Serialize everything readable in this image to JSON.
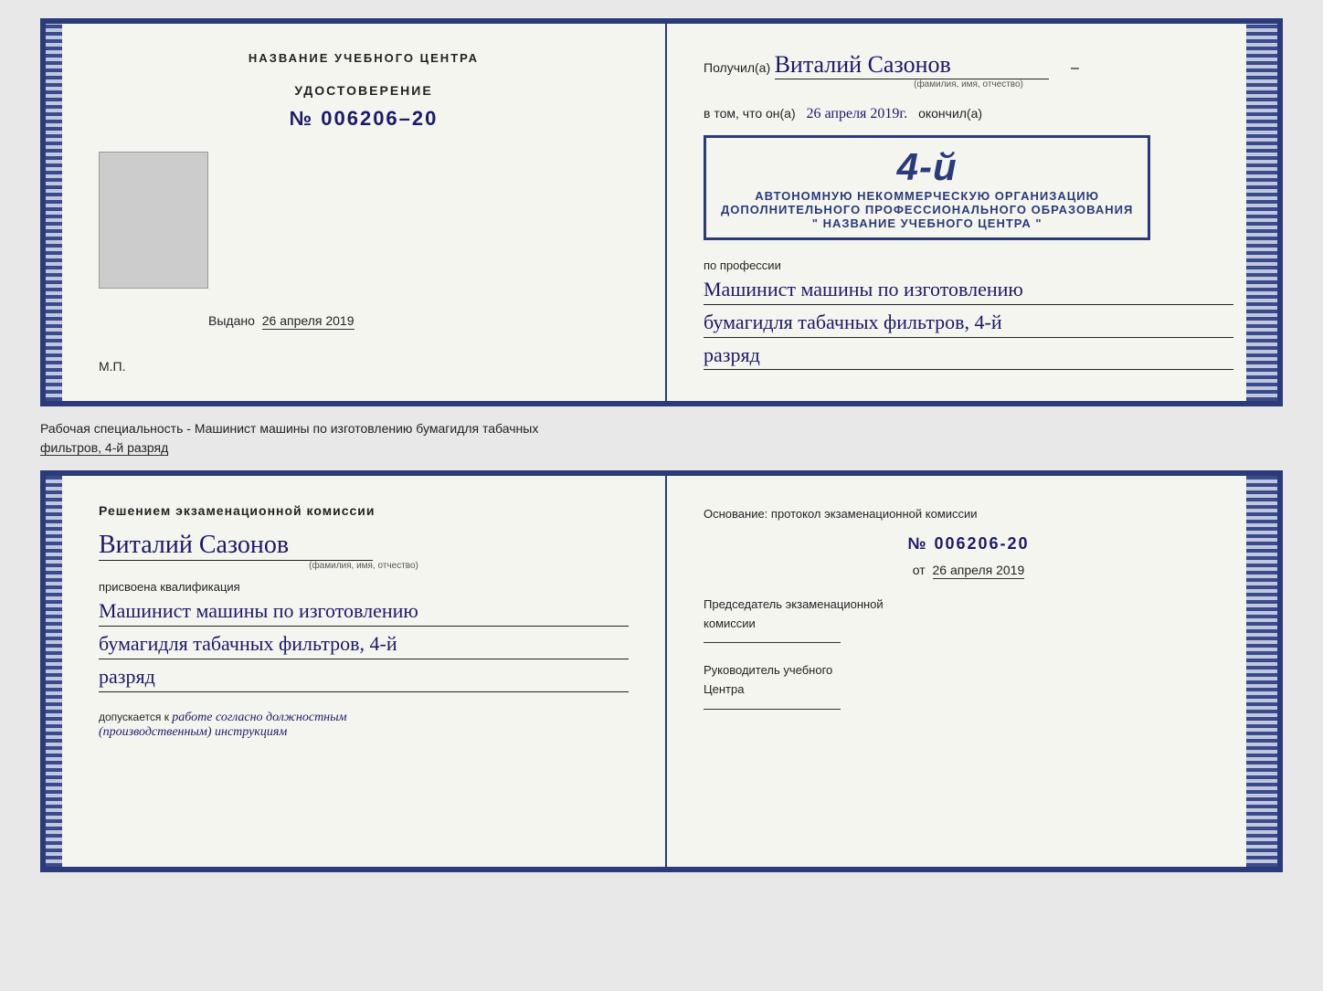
{
  "top_doc": {
    "left": {
      "photo_placeholder": "",
      "udostoverenie_label": "УДОСТОВЕРЕНИЕ",
      "number": "№ 006206–20",
      "vydano_label": "Выдано",
      "vydano_date": "26 апреля 2019",
      "mp_label": "М.П."
    },
    "right": {
      "poluchil_label": "Получил(а)",
      "fio_handwritten": "Виталий Сазонов",
      "fio_sub": "(фамилия, имя, отчество)",
      "dash": "–",
      "vtom_label": "в том, что он(а)",
      "date_handwritten": "26 апреля 2019г.",
      "okanchil_label": "окончил(а)",
      "stamp_line1": "АВТОНОМНУЮ НЕКОММЕРЧЕСКУЮ ОРГАНИЗАЦИЮ",
      "stamp_line2": "ДОПОЛНИТЕЛЬНОГО ПРОФЕССИОНАЛЬНОГО ОБРАЗОВАНИЯ",
      "stamp_line3": "\" НАЗВАНИЕ УЧЕБНОГО ЦЕНТРА \"",
      "stamp_number": "4-й",
      "po_professii_label": "по профессии",
      "profession_line1": "Машинист машины по изготовлению",
      "profession_line2": "бумагидля табачных фильтров, 4-й",
      "profession_line3": "разряд",
      "top_title": "НАЗВАНИЕ УЧЕБНОГО ЦЕНТРА"
    }
  },
  "info_line": {
    "text1": "Рабочая специальность - Машинист машины по изготовлению бумагидля табачных",
    "text2": "фильтров, 4-й разряд"
  },
  "bottom_doc": {
    "left": {
      "resheniem_title": "Решением  экзаменационной  комиссии",
      "fio_handwritten": "Виталий Сазонов",
      "fio_sub": "(фамилия, имя, отчество)",
      "prisvoena_label": "присвоена квалификация",
      "profession_line1": "Машинист машины по изготовлению",
      "profession_line2": "бумагидля табачных фильтров, 4-й",
      "profession_line3": "разряд",
      "dopusk_label": "допускается к",
      "dopusk_handwritten": "работе согласно должностным",
      "dopusk_handwritten2": "(производственным) инструкциям"
    },
    "right": {
      "osnovanie_label": "Основание:  протокол  экзаменационной  комиссии",
      "number": "№  006206-20",
      "ot_label": "от",
      "ot_date": "26 апреля 2019",
      "predsedatel_label": "Председатель экзаменационной",
      "predsedatel_label2": "комиссии",
      "rukovoditel_label": "Руководитель учебного",
      "rukovoditel_label2": "Центра"
    }
  }
}
